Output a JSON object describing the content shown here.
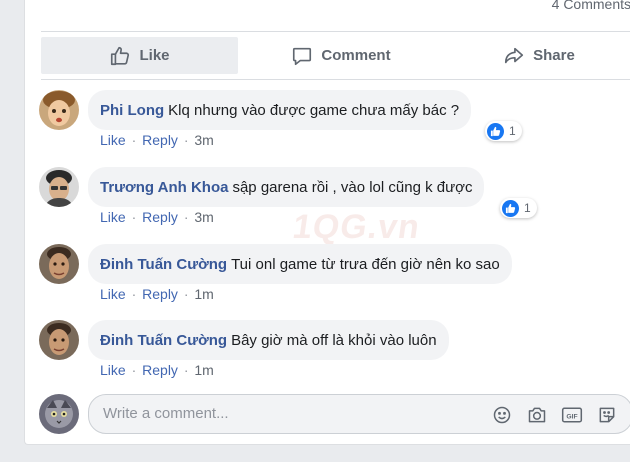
{
  "header": {
    "comment_count": "4 Comments"
  },
  "actions": {
    "like": "Like",
    "comment": "Comment",
    "share": "Share"
  },
  "comments": [
    {
      "author": "Phi Long",
      "text": "Klq nhưng vào được game chưa mấy bác ?",
      "like": "Like",
      "reply": "Reply",
      "time": "3m",
      "reactions": "1"
    },
    {
      "author": "Trương Anh Khoa",
      "text": "sập garena rồi , vào lol cũng k được",
      "like": "Like",
      "reply": "Reply",
      "time": "3m",
      "reactions": "1"
    },
    {
      "author": "Đinh Tuấn Cường",
      "text": "Tui onl game từ trưa đến giờ nên ko sao",
      "like": "Like",
      "reply": "Reply",
      "time": "1m"
    },
    {
      "author": "Đinh Tuấn Cường",
      "text": "Bây giờ mà off là khỏi vào luôn",
      "like": "Like",
      "reply": "Reply",
      "time": "1m"
    }
  ],
  "composer": {
    "placeholder": "Write a comment..."
  },
  "watermark": {
    "text": "1QG.vn"
  },
  "icons": {
    "like": "thumbs-up-icon",
    "comment": "speech-bubble-icon",
    "share": "share-arrow-icon",
    "emoji": "smiley-icon",
    "camera": "camera-icon",
    "gif": "gif-icon",
    "sticker": "sticker-icon"
  },
  "colors": {
    "author": "#385898",
    "link": "#4267b2",
    "reaction": "#1877f2"
  }
}
